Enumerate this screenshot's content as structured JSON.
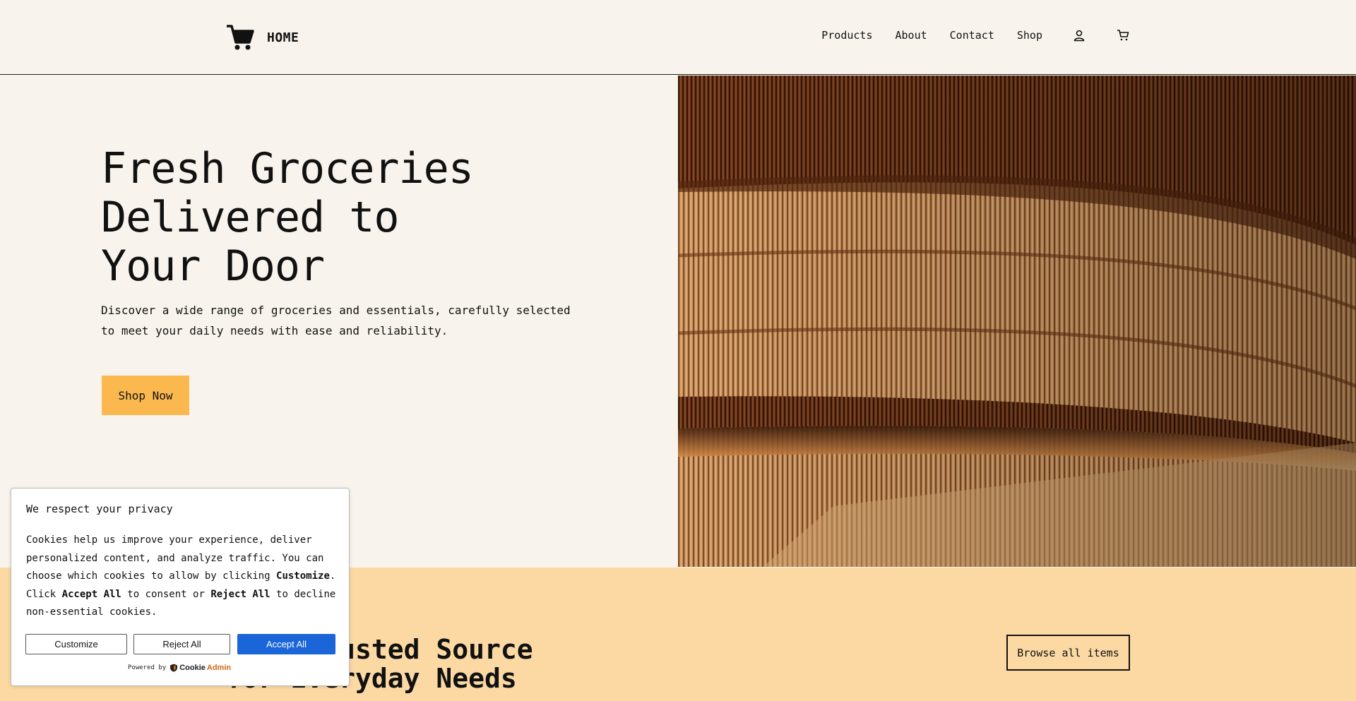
{
  "header": {
    "logo_text": "HOME",
    "nav": [
      {
        "label": "Products"
      },
      {
        "label": "About"
      },
      {
        "label": "Contact"
      },
      {
        "label": "Shop"
      }
    ],
    "icons": [
      "user-icon",
      "cart-icon"
    ]
  },
  "hero": {
    "title_line1": "Fresh Groceries",
    "title_line2": "Delivered to",
    "title_line3": "Your Door",
    "subtitle": "Discover a wide range of groceries and essentials, carefully selected to meet your daily needs with ease and reliability.",
    "cta_label": "Shop Now"
  },
  "section2": {
    "title_line1": "Your Trusted Source",
    "title_line2": "for Everyday Needs",
    "browse_label": "Browse all items"
  },
  "cookie": {
    "title": "We respect your privacy",
    "body_part1": "Cookies help us improve your experience, deliver personalized content, and analyze traffic. You can choose which cookies to allow by clicking ",
    "body_bold1": "Customize",
    "body_part2": ". Click ",
    "body_bold2": "Accept All",
    "body_part3": " to consent or ",
    "body_bold3": "Reject All",
    "body_part4": " to decline non-essential cookies.",
    "customize_label": "Customize",
    "reject_label": "Reject All",
    "accept_label": "Accept All",
    "powered_by": "Powered by",
    "brand_part1": "Cookie",
    "brand_part2": "Admin"
  },
  "colors": {
    "background": "#f8f4ed",
    "accent": "#fbb84f",
    "section2_bg": "#fcd9a3",
    "accept_blue": "#1a66d8",
    "brand_orange": "#c76a12"
  }
}
